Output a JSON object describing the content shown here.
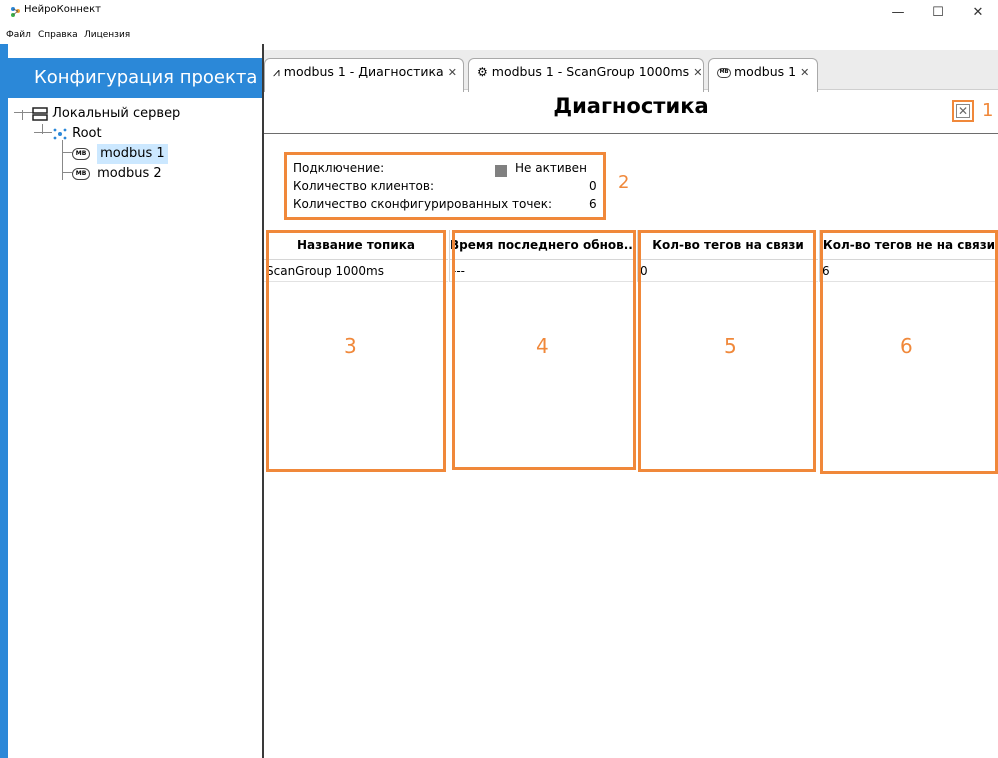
{
  "window": {
    "title": "НейроКоннект",
    "controls": {
      "minimize": "—",
      "maximize": "☐",
      "close": "✕"
    }
  },
  "menu": [
    "Файл",
    "Справка",
    "Лицензия"
  ],
  "sidebar": {
    "header": "Конфигурация проекта",
    "tree": {
      "server": "Локальный сервер",
      "root": "Root",
      "items": [
        {
          "label": "modbus 1",
          "icon": "MB",
          "selected": true
        },
        {
          "label": "modbus 2",
          "icon": "MB",
          "selected": false
        }
      ]
    }
  },
  "tabs": [
    {
      "label": "modbus 1 - Диагностика",
      "icon": "diagnostics-icon",
      "active": true
    },
    {
      "label": "modbus 1 - ScanGroup 1000ms",
      "icon": "scangroup-icon",
      "active": false
    },
    {
      "label": "modbus 1",
      "icon": "MB",
      "active": false
    }
  ],
  "diagnostics": {
    "title": "Диагностика",
    "close_symbol": "✕",
    "annotations": [
      "1",
      "2",
      "3",
      "4",
      "5",
      "6"
    ],
    "info": {
      "connection_label": "Подключение:",
      "connection_value": "Не активен",
      "clients_label": "Количество клиентов:",
      "clients_value": "0",
      "points_label": "Количество сконфигурированных точек:",
      "points_value": "6"
    },
    "columns": [
      "Название топика",
      "Время последнего обнов...",
      "Кол-во тегов на связи",
      "Кол-во тегов не на связи"
    ],
    "rows": [
      [
        "ScanGroup 1000ms",
        "---",
        "0",
        "6"
      ]
    ]
  },
  "colors": {
    "accent": "#2b88d8",
    "annotation": "#f0883a",
    "selection": "#cce8ff"
  }
}
